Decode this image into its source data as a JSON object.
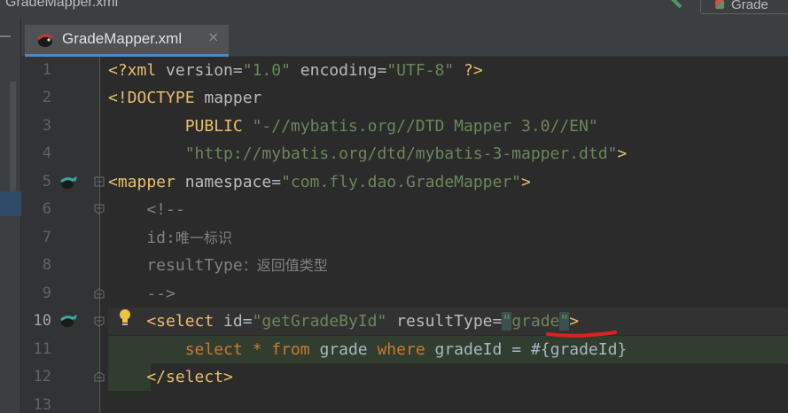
{
  "window": {
    "title": "GradeMapper.xml",
    "run_config_label": "Grade"
  },
  "tabs": [
    {
      "label": "GradeMapper.xml",
      "close": "×",
      "active": true
    }
  ],
  "editor": {
    "current_line": 10,
    "line_numbers": [
      "1",
      "2",
      "3",
      "4",
      "5",
      "6",
      "7",
      "8",
      "9",
      "10",
      "11",
      "12",
      "13"
    ],
    "lines": {
      "l1": {
        "a": "<?xml ",
        "b": "version",
        "c": "=",
        "d": "\"1.0\"",
        "e": " ",
        "f": "encoding",
        "g": "=",
        "h": "\"UTF-8\"",
        "i": " ?>"
      },
      "l2": {
        "a": "<!DOCTYPE ",
        "b": "mapper"
      },
      "l3": {
        "a": "        PUBLIC ",
        "b": "\"-//mybatis.org//DTD Mapper 3.0//EN\""
      },
      "l4": {
        "a": "        ",
        "b": "\"http://mybatis.org/dtd/mybatis-3-mapper.dtd\"",
        "c": ">"
      },
      "l5": {
        "a": "<mapper ",
        "b": "namespace",
        "c": "=",
        "d": "\"com.fly.dao.GradeMapper\"",
        "e": ">"
      },
      "l6": {
        "a": "    <!--"
      },
      "l7": {
        "a": "    id:",
        "b": "唯一标识"
      },
      "l8": {
        "a": "    resultType",
        "b": "：返回值类型"
      },
      "l9": {
        "a": "    -->"
      },
      "l10": {
        "a": "    <select ",
        "b": "id",
        "c": "=",
        "d": "\"getGradeById\"",
        "e": " ",
        "f": "resultType",
        "g": "=",
        "h": "\"",
        "i": "grade",
        "j": "\"",
        "k": ">"
      },
      "l11": {
        "a": "        select ",
        "b": "*",
        "c": " from ",
        "d": "grade ",
        "e": "where ",
        "f": "gradeId = #",
        "g": "{",
        "h": "gradeId",
        "i": "}"
      },
      "l12": {
        "a": "    </select",
        "b": ">"
      }
    }
  },
  "colors": {
    "background": "#2b2b2b",
    "tag": "#e8bf6a",
    "attribute_value": "#6a8759",
    "keyword": "#cc7832",
    "comment": "#808080",
    "annotation_underline": "#e02020"
  },
  "icons": {
    "file_tab": "mybatis-bird-icon",
    "gutter_mapper": "mybatis-navigate-icon",
    "gutter_select": "mybatis-navigate-icon",
    "intention": "lightbulb-icon",
    "fold": "fold-marker-icon",
    "close": "close-icon",
    "run_config": "run-config-icon",
    "build": "hammer-icon"
  }
}
